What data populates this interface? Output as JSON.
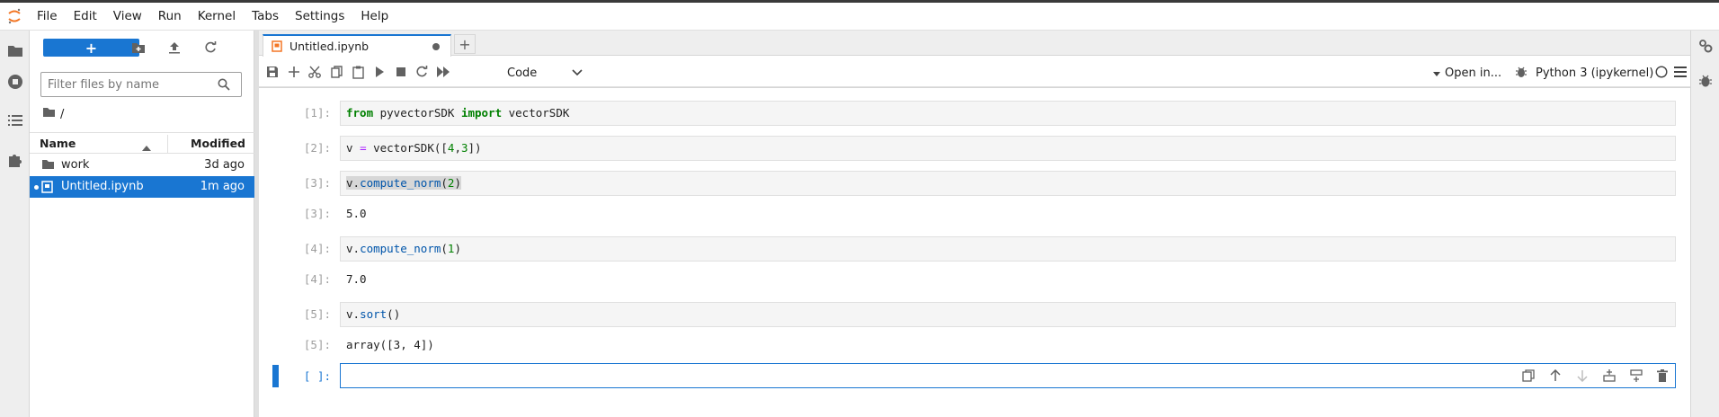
{
  "menubar": {
    "items": [
      "File",
      "Edit",
      "View",
      "Run",
      "Kernel",
      "Tabs",
      "Settings",
      "Help"
    ]
  },
  "filebrowser": {
    "new_label": "+",
    "filter_placeholder": "Filter files by name",
    "breadcrumb": "/",
    "header": {
      "name": "Name",
      "modified": "Modified"
    },
    "files": [
      {
        "name": "work",
        "modified": "3d ago",
        "type": "folder",
        "selected": false
      },
      {
        "name": "Untitled.ipynb",
        "modified": "1m ago",
        "type": "notebook",
        "selected": true
      }
    ]
  },
  "tab": {
    "label": "Untitled.ipynb",
    "new_tab": "+"
  },
  "toolbar": {
    "cell_type": "Code",
    "open_in": "Open in...",
    "kernel": "Python 3 (ipykernel)"
  },
  "cells": [
    {
      "prompt": "[1]:",
      "code": "from pyvectorSDK import vectorSDK"
    },
    {
      "prompt": "[2]:",
      "code": "v = vectorSDK([4,3])"
    },
    {
      "prompt": "[3]:",
      "code": "v.compute_norm(2)",
      "out_prompt": "[3]:",
      "output": "5.0"
    },
    {
      "prompt": "[4]:",
      "code": "v.compute_norm(1)",
      "out_prompt": "[4]:",
      "output": "7.0"
    },
    {
      "prompt": "[5]:",
      "code": "v.sort()",
      "out_prompt": "[5]:",
      "output": "array([3, 4])"
    },
    {
      "prompt": "[ ]:",
      "code": ""
    }
  ],
  "colors": {
    "accent": "#1976d2",
    "keyword": "#008000",
    "function": "#0055aa"
  }
}
